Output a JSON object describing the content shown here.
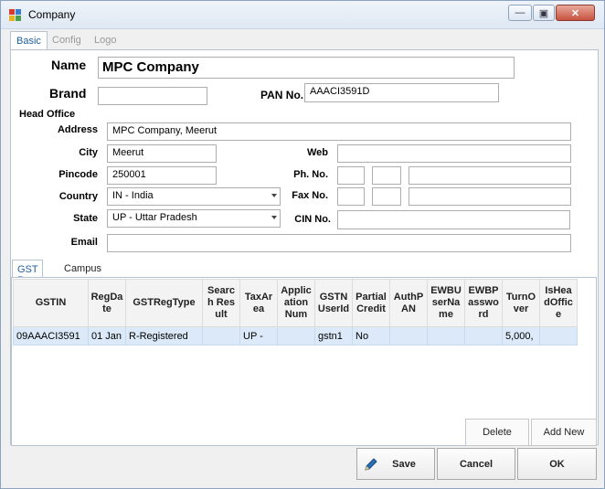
{
  "window": {
    "title": "Company"
  },
  "tabs_top": [
    "Basic",
    "Config",
    "Logo"
  ],
  "basic": {
    "name_label": "Name",
    "name_value": "MPC Company",
    "brand_label": "Brand",
    "brand_value": "",
    "pan_label": "PAN No.",
    "pan_value": "AAACI3591D"
  },
  "head_office": {
    "title": "Head Office",
    "address_label": "Address",
    "address_value": "MPC Company, Meerut",
    "city_label": "City",
    "city_value": "Meerut",
    "pincode_label": "Pincode",
    "pincode_value": "250001",
    "country_label": "Country",
    "country_value": "IN - India",
    "state_label": "State",
    "state_value": "UP - Uttar Pradesh",
    "email_label": "Email",
    "email_value": "",
    "web_label": "Web",
    "web_value": "",
    "phone_label": "Ph. No.",
    "fax_label": "Fax No.",
    "cin_label": "CIN No.",
    "cin_value": ""
  },
  "tabs_inner": [
    "GST Reg",
    "Campus"
  ],
  "grid": {
    "columns": [
      "GSTIN",
      "RegDate",
      "GSTRegType",
      "Search Result",
      "TaxArea",
      "Application Num",
      "GSTN UserId",
      "Partial Credit",
      "AuthPAN",
      "EWBUserName",
      "EWBPassword",
      "TurnOver",
      "IsHeadOffice"
    ],
    "rows": [
      [
        "09AAACI3591",
        "01 Jan",
        "R-Registered",
        "",
        "UP -",
        "",
        "gstn1",
        "No",
        "",
        "",
        "",
        "5,000,",
        ""
      ]
    ],
    "delete_label": "Delete",
    "add_label": "Add New"
  },
  "footer": {
    "save_label": "Save",
    "cancel_label": "Cancel",
    "ok_label": "OK"
  },
  "colors": {
    "accent": "#1d5f9e",
    "selected_row": "#dbe9f8"
  }
}
